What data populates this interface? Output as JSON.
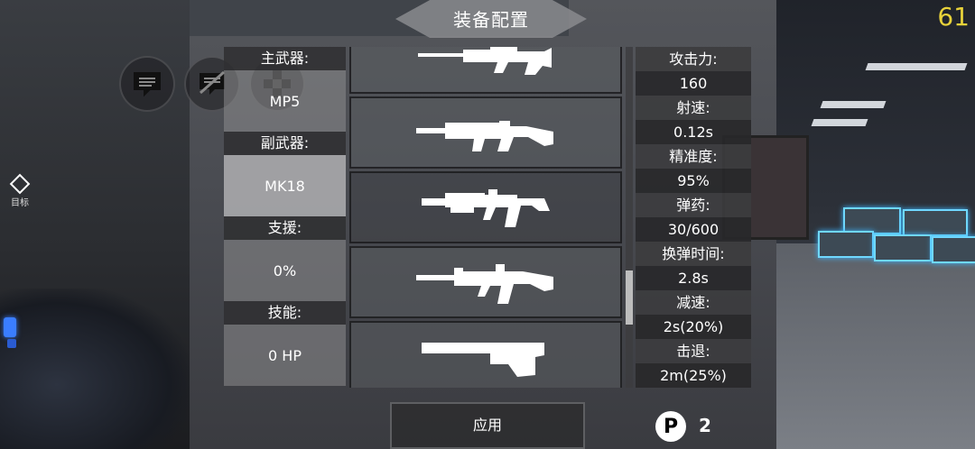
{
  "title": "装备配置",
  "fps_counter": "61",
  "target_marker_label": "目标",
  "slots": [
    {
      "header": "主武器:",
      "value": "MP5"
    },
    {
      "header": "副武器:",
      "value": "MK18"
    },
    {
      "header": "支援:",
      "value": "0%"
    },
    {
      "header": "技能:",
      "value": "0 HP"
    }
  ],
  "weapons": [
    {
      "icon": "sniper-rifle-icon"
    },
    {
      "icon": "battle-rifle-icon"
    },
    {
      "icon": "carbine-icon"
    },
    {
      "icon": "assault-rifle-icon"
    },
    {
      "icon": "launcher-icon"
    }
  ],
  "stats": [
    {
      "label": "攻击力:",
      "value": "160"
    },
    {
      "label": "射速:",
      "value": "0.12s"
    },
    {
      "label": "精准度:",
      "value": "95%"
    },
    {
      "label": "弹药:",
      "value": "30/600"
    },
    {
      "label": "换弹时间:",
      "value": "2.8s"
    },
    {
      "label": "减速:",
      "value": "2s(20%)"
    },
    {
      "label": "击退:",
      "value": "2m(25%)"
    }
  ],
  "apply_label": "应用",
  "points_symbol": "P",
  "points_value": "2",
  "colors": {
    "fps": "#e8d23a",
    "crate_glow": "#6fd8ff"
  }
}
